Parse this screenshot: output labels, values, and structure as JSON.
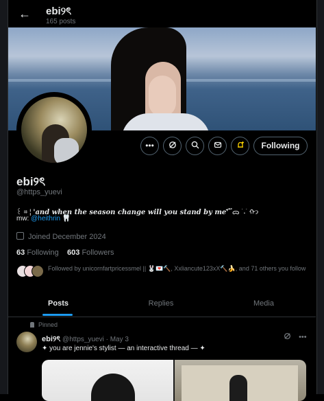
{
  "header": {
    "back_icon": "arrow-left-icon",
    "name": "ebi୨ৎ",
    "post_count": "165 posts"
  },
  "profile": {
    "display_name": "ebi୨ৎ",
    "handle": "@https_yuevi",
    "bio_prefix": "꒰ ⌗ ¦ ",
    "bio_quote": "'and when the season change will you stand by me'",
    "bio_suffix": " ፝֟ ᯅ ࣪ ˖ ࣪ ᡣ𐭩",
    "bio_mw_label": "mw: ",
    "bio_mw_link": "@heithrin",
    "bio_mw_emoji": "🦷",
    "joined": "Joined December 2024",
    "following_count": "63",
    "following_label": "Following",
    "followers_count": "603",
    "followers_label": "Followers",
    "followed_by": "Followed by unicornfartpricessmel || 🐰💌🔨, Xxliancute123xX🔨🍌, and 71 others you follow"
  },
  "actions": {
    "more_icon": "more-icon",
    "grok_icon": "grok-icon",
    "search_icon": "search-icon",
    "message_icon": "mail-icon",
    "notify_icon": "bell-plus-icon",
    "follow_label": "Following"
  },
  "tabs": [
    "Posts",
    "Replies",
    "Media"
  ],
  "pinned_post": {
    "pinned_label": "Pinned",
    "name": "ebi୨ৎ",
    "handle": "@https_yuevi",
    "date": "May 3",
    "text": "✦ you are jennie's stylist — an interactive thread — ✦"
  },
  "colors": {
    "background": "#000000",
    "accent": "#1d9bf0",
    "muted": "#71767b",
    "notify_highlight": "#ffd400"
  }
}
